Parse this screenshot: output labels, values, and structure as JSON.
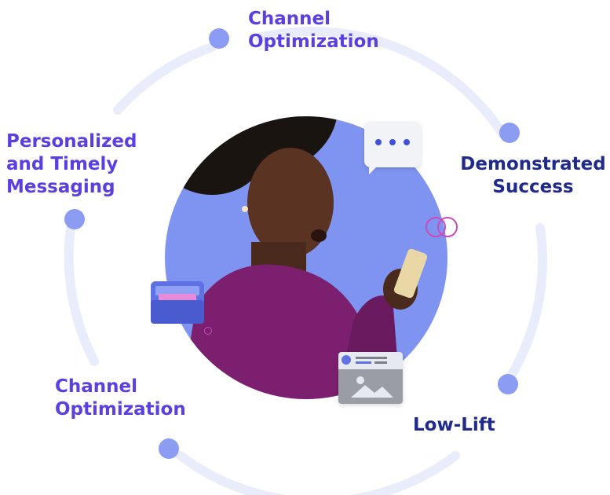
{
  "labels": {
    "top": "Channel Optimization",
    "top_line1": "Channel",
    "top_line2": "Optimization",
    "right": "Demonstrated Success",
    "right_line1": "Demonstrated",
    "right_line2": "Success",
    "bottom_right": "Low-Lift",
    "bottom_left_line1": "Channel",
    "bottom_left_line2": "Optimization",
    "left_line1": "Personalized",
    "left_line2": "and Timely",
    "left_line3": "Messaging"
  },
  "colors": {
    "label_primary": "#5b3fe0",
    "label_dark": "#1f2a8a",
    "ring": "#e9ecfb",
    "dot": "#8c9cf2",
    "photo_bg": "#7f94f0",
    "sweater": "#7b1f6e"
  },
  "icons": [
    "chat-bubble-icon",
    "wallet-icon",
    "media-card-icon",
    "overlapping-rings-icon"
  ]
}
